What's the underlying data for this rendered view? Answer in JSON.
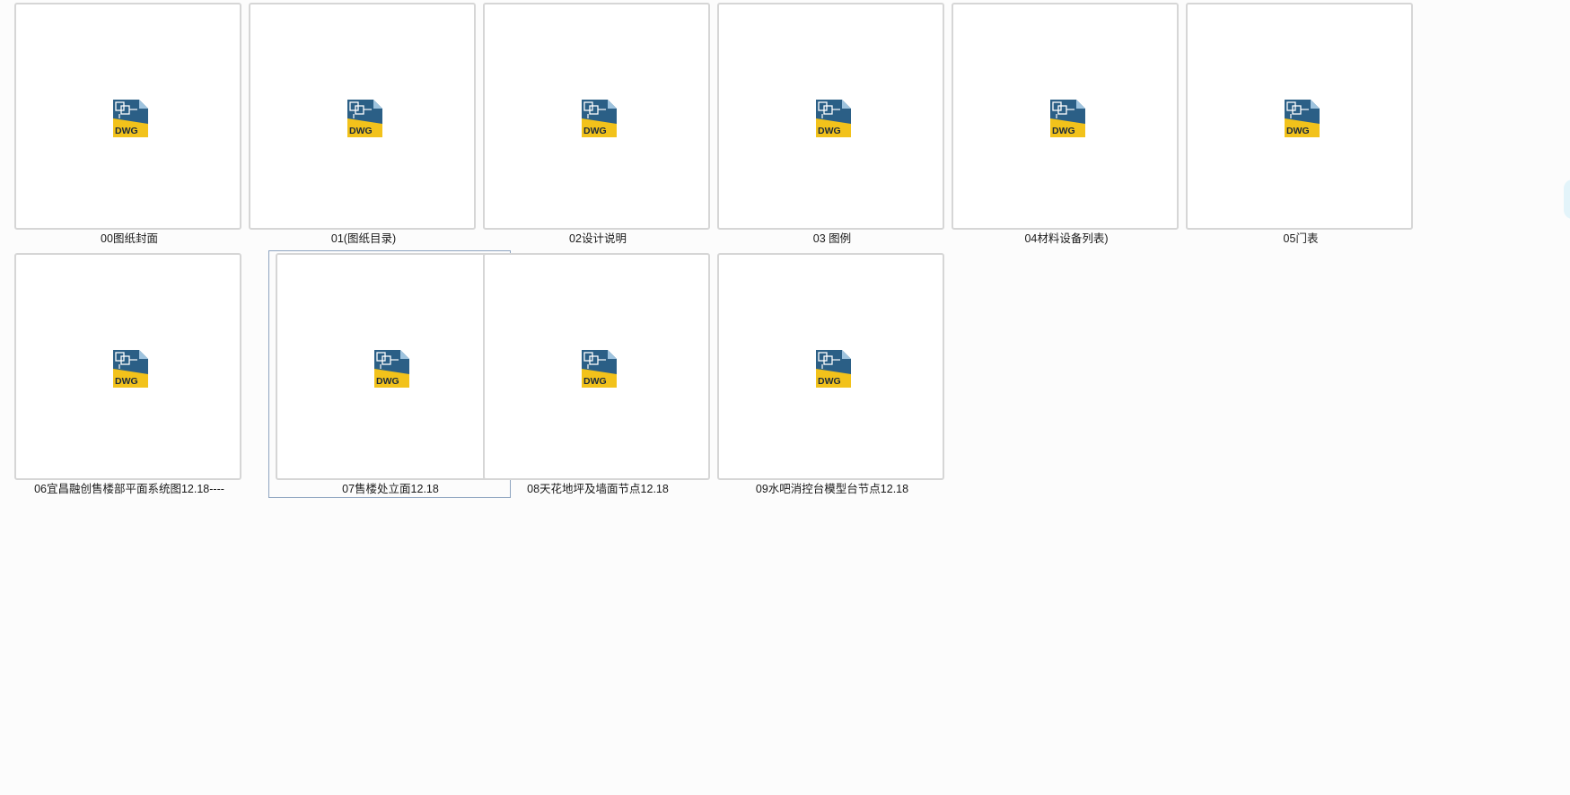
{
  "files": [
    {
      "name": "00图纸封面",
      "icon": "dwg-file-icon",
      "icon_label": "DWG"
    },
    {
      "name": "01(图纸目录)",
      "icon": "dwg-file-icon",
      "icon_label": "DWG"
    },
    {
      "name": "02设计说明",
      "icon": "dwg-file-icon",
      "icon_label": "DWG"
    },
    {
      "name": "03 图例",
      "icon": "dwg-file-icon",
      "icon_label": "DWG"
    },
    {
      "name": "04材料设备列表)",
      "icon": "dwg-file-icon",
      "icon_label": "DWG"
    },
    {
      "name": "05门表",
      "icon": "dwg-file-icon",
      "icon_label": "DWG"
    },
    {
      "name": "06宜昌融创售楼部平面系统图12.18----",
      "icon": "dwg-file-icon",
      "icon_label": "DWG"
    },
    {
      "name": "07售楼处立面12.18",
      "icon": "dwg-file-icon",
      "icon_label": "DWG",
      "selected": true
    },
    {
      "name": "08天花地坪及墙面节点12.18",
      "icon": "dwg-file-icon",
      "icon_label": "DWG"
    },
    {
      "name": "09水吧消控台模型台节点12.18",
      "icon": "dwg-file-icon",
      "icon_label": "DWG"
    }
  ],
  "colors": {
    "background": "#fcfcfc",
    "thumb_border": "#d6d6d6",
    "selection_border": "#8ea4c0",
    "icon_blue": "#2b5f86",
    "icon_yellow": "#f2c21b"
  }
}
